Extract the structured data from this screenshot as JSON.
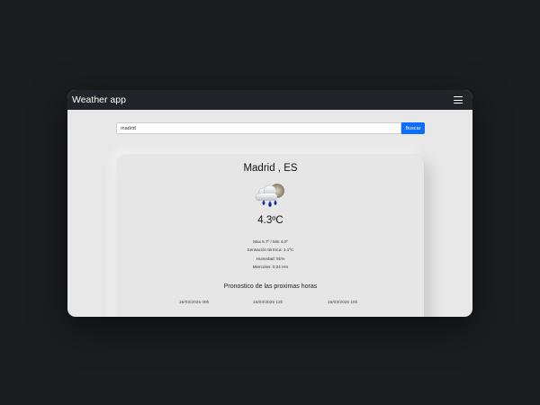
{
  "navbar": {
    "brand": "Weather app",
    "menu_icon": "hamburger-menu-icon"
  },
  "search": {
    "value": "madrid",
    "button_label": "Buscar"
  },
  "weather": {
    "location": "Madrid , ES",
    "icon": "cloud-rain-icon",
    "temperature": "4.3ºC",
    "max_min": "Max 5.7º / Min 4.0º",
    "feels_like": "Sensación térmica: 1.1ºC",
    "humidity": "Humedad: 91%",
    "time": "Miercoles: 0:24 Hrs"
  },
  "forecast": {
    "title": "Pronostico de las proximas horas",
    "items": [
      "16/03/2025 09h",
      "16/03/2025 12h",
      "16/03/2025 15h"
    ]
  },
  "colors": {
    "navbar": "#212529",
    "button": "#0d6efd",
    "page_background": "#1c1d1f"
  }
}
